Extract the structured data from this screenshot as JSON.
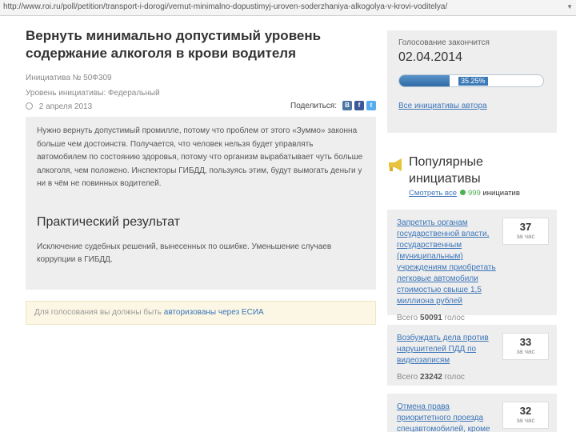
{
  "browser": {
    "url": "http://www.roi.ru/poll/petition/transport-i-dorogi/vernut-minimalno-dopustimyj-uroven-soderzhaniya-alkogolya-v-krovi-voditelya/"
  },
  "petition": {
    "title": "Вернуть минимально допустимый уровень содержание алкоголя в крови водителя",
    "number_line": "Инициатива № 50Ф309",
    "level_line": "Уровень инициативы: Федеральный",
    "date": "2 апреля 2013",
    "description": "Нужно вернуть допустимый промилле, потому что проблем от этого «Зуммо» законна больше чем достоинств. Получается, что человек нельзя будет управлять автомобилем по состоянию здоровья, потому что организм вырабатывает чуть больше алкоголя, чем положено. Инспекторы ГИБДД, пользуясь этим, будут вымогать деньги у ни в чём не повинных водителей.",
    "result_heading": "Практический результат",
    "result_text": "Исключение судебных решений, вынесенных по ошибке. Уменьшение случаев коррупции в ГИБДД.",
    "notice_text": "Для голосования вы должны быть ",
    "notice_link": "авторизованы через ЕСИА"
  },
  "share": {
    "label": "Поделиться:",
    "icons": [
      "vk-icon",
      "facebook-icon",
      "twitter-icon"
    ]
  },
  "vote": {
    "label": "Голосование закончится",
    "end_date": "02.04.2014",
    "progress_label": "35.25%",
    "progress_fraction": 0.3525,
    "all_link": "Все инициативы автора"
  },
  "popular": {
    "title": "Популярные инициативы",
    "see_all": "Смотреть все",
    "count": "999",
    "count_word": "инициатив",
    "items": [
      {
        "title": "Запретить органам государственной власти, государственным (муниципальным) учреждениям приобретать легковые автомобили стоимостью свыше 1,5 миллиона рублей",
        "total_label": "Всего",
        "total": "50091",
        "total_unit": "голос",
        "score": "37",
        "score_unit": "за час"
      },
      {
        "title": "Возбуждать дела против нарушителей ПДД по видеозаписям",
        "total_label": "Всего",
        "total": "23242",
        "total_unit": "голос",
        "score": "33",
        "score_unit": "за час"
      },
      {
        "title": "Отмена права приоритетного проезда спецавтомобилей, кроме",
        "total_label": "",
        "total": "",
        "total_unit": "",
        "score": "32",
        "score_unit": "за час"
      }
    ]
  },
  "colors": {
    "link": "#3a74b8",
    "panel": "#eeeeee",
    "progress": "#2e6aa5",
    "green": "#4caf50"
  }
}
